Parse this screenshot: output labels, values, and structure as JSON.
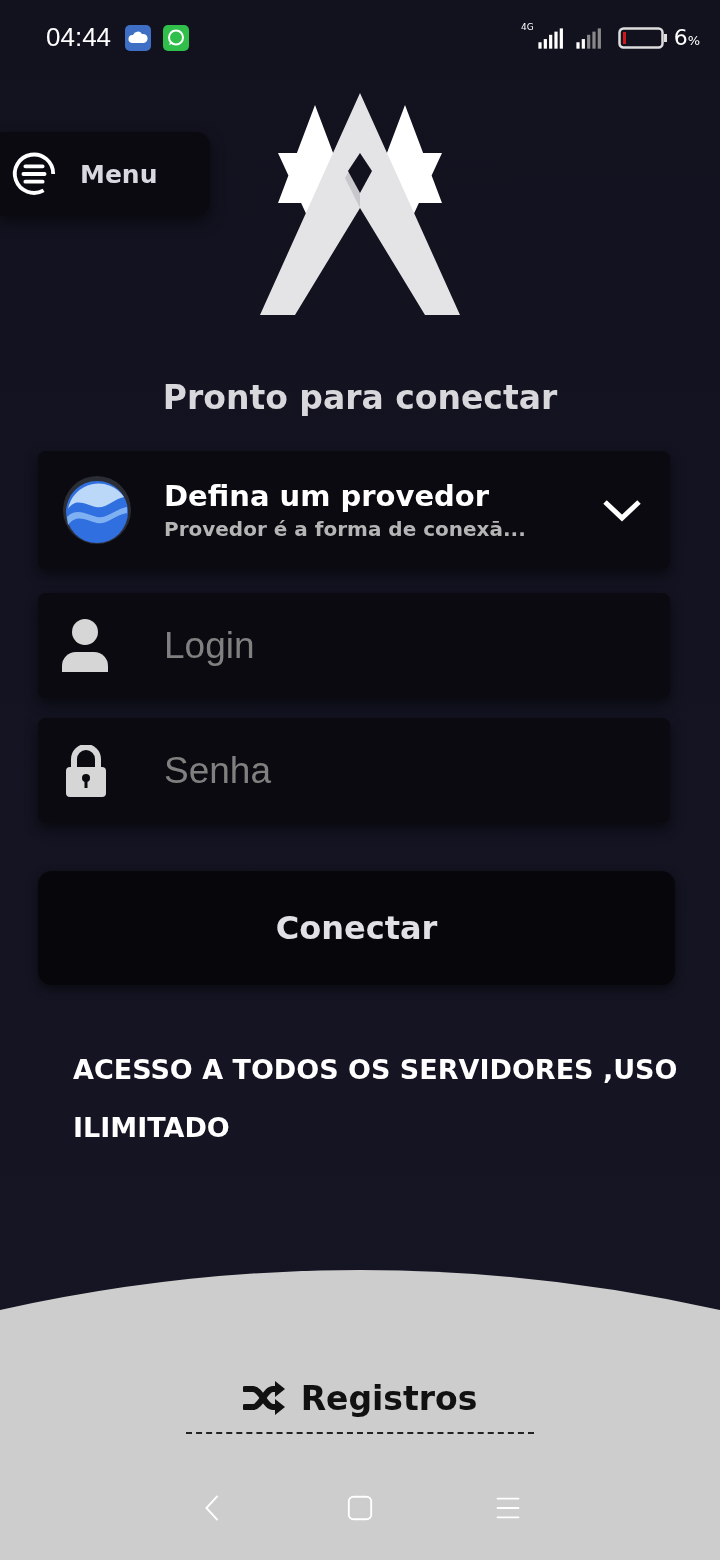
{
  "status_bar": {
    "time": "04:44",
    "network": "4G",
    "battery": "6",
    "battery_unit": "%"
  },
  "menu": {
    "label": "Menu"
  },
  "title": "Pronto para conectar",
  "provider": {
    "title": "Defina um provedor",
    "subtitle": "Provedor é a forma de conexā..."
  },
  "login": {
    "placeholder": "Login"
  },
  "password": {
    "placeholder": "Senha"
  },
  "connect_button": "Conectar",
  "message": "ACESSO A TODOS OS SERVIDORES ,USO ILIMITADO",
  "logs": {
    "label": "Registros"
  }
}
